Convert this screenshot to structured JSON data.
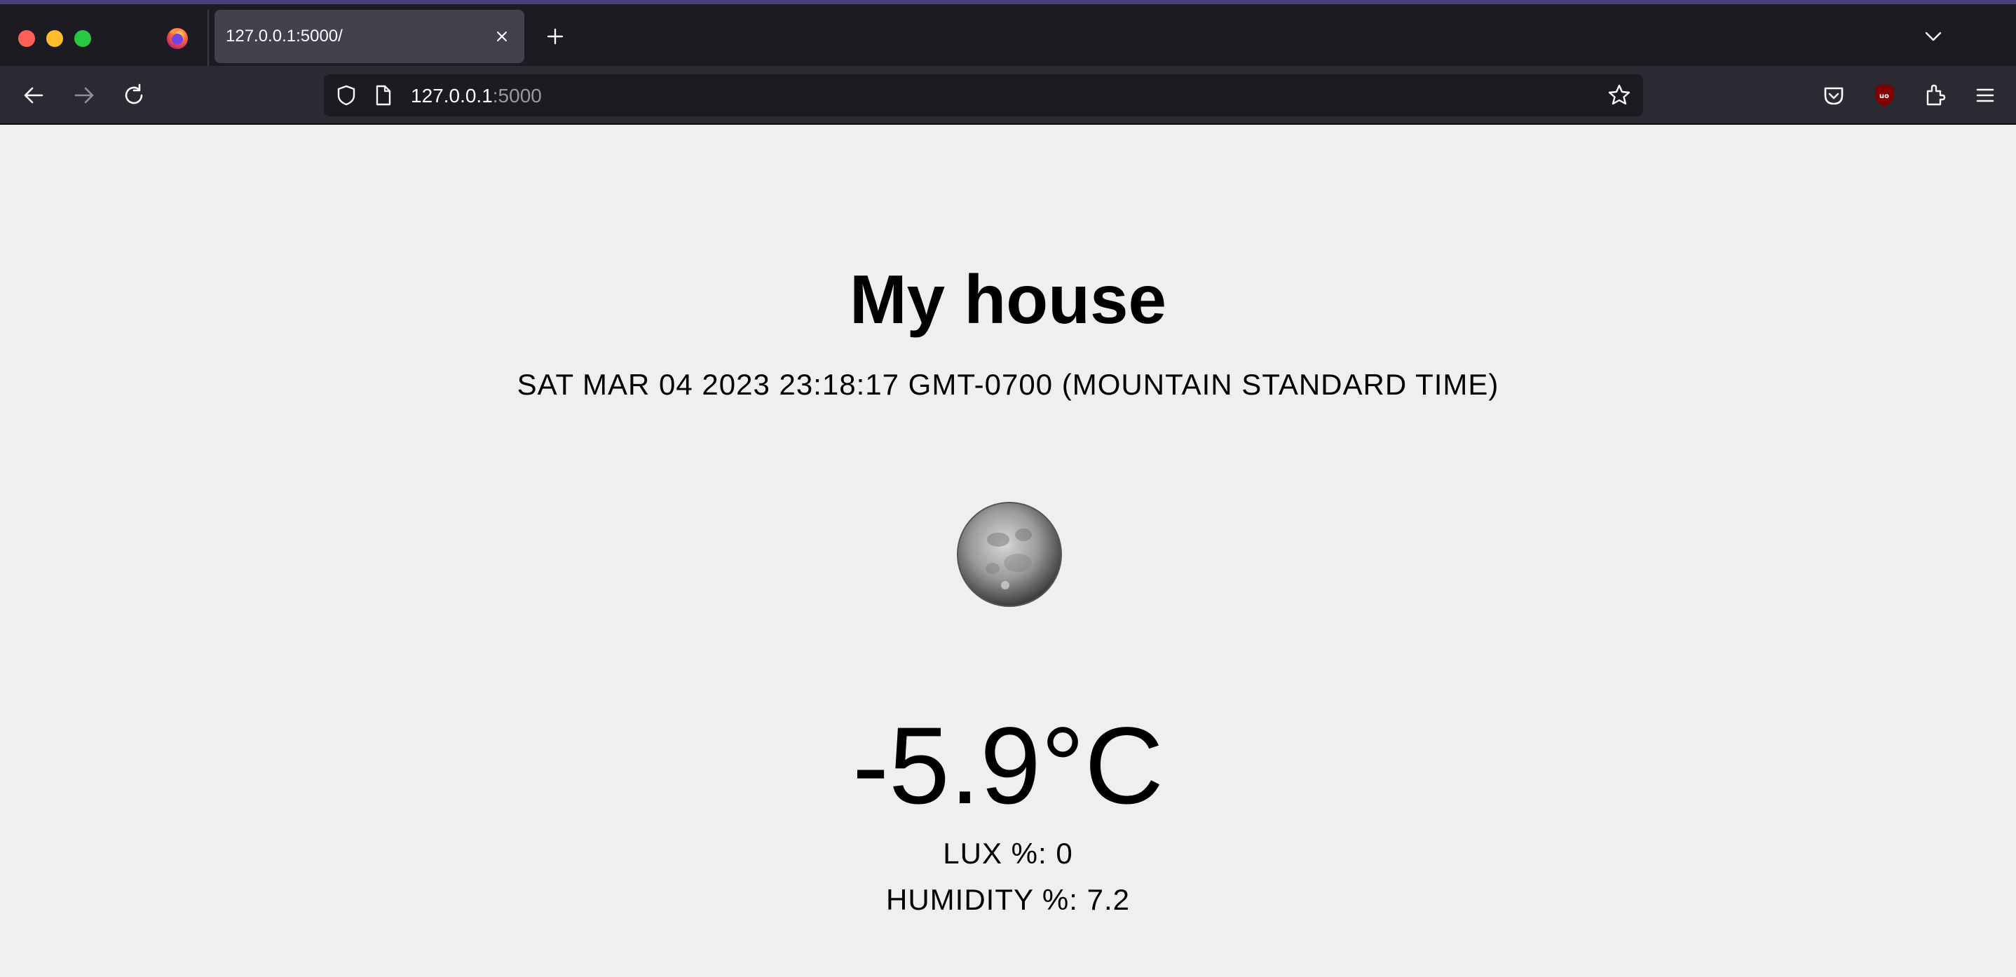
{
  "browser": {
    "tab_title": "127.0.0.1:5000/",
    "url_host": "127.0.0.1",
    "url_port": ":5000",
    "accent_color": "#4a3f7a"
  },
  "icons": {
    "window": [
      "close-window-icon",
      "minimize-window-icon",
      "maximize-window-icon"
    ],
    "tab": [
      "firefox-logo-icon",
      "tab-close-icon",
      "new-tab-icon",
      "tab-list-chevron-icon"
    ],
    "nav": [
      "back-arrow-icon",
      "forward-arrow-icon",
      "reload-icon"
    ],
    "urlbar": [
      "shield-icon",
      "page-icon",
      "bookmark-star-icon"
    ],
    "toolbar": [
      "pocket-icon",
      "ublock-origin-icon",
      "extensions-icon",
      "menu-icon"
    ],
    "content": [
      "moon-icon"
    ]
  },
  "page": {
    "title": "My house",
    "datetime": "SAT MAR 04 2023 23:18:17 GMT-0700 (MOUNTAIN STANDARD TIME)",
    "temperature": "-5.9°C",
    "lux": "LUX %: 0",
    "humidity": "HUMIDITY %: 7.2"
  }
}
